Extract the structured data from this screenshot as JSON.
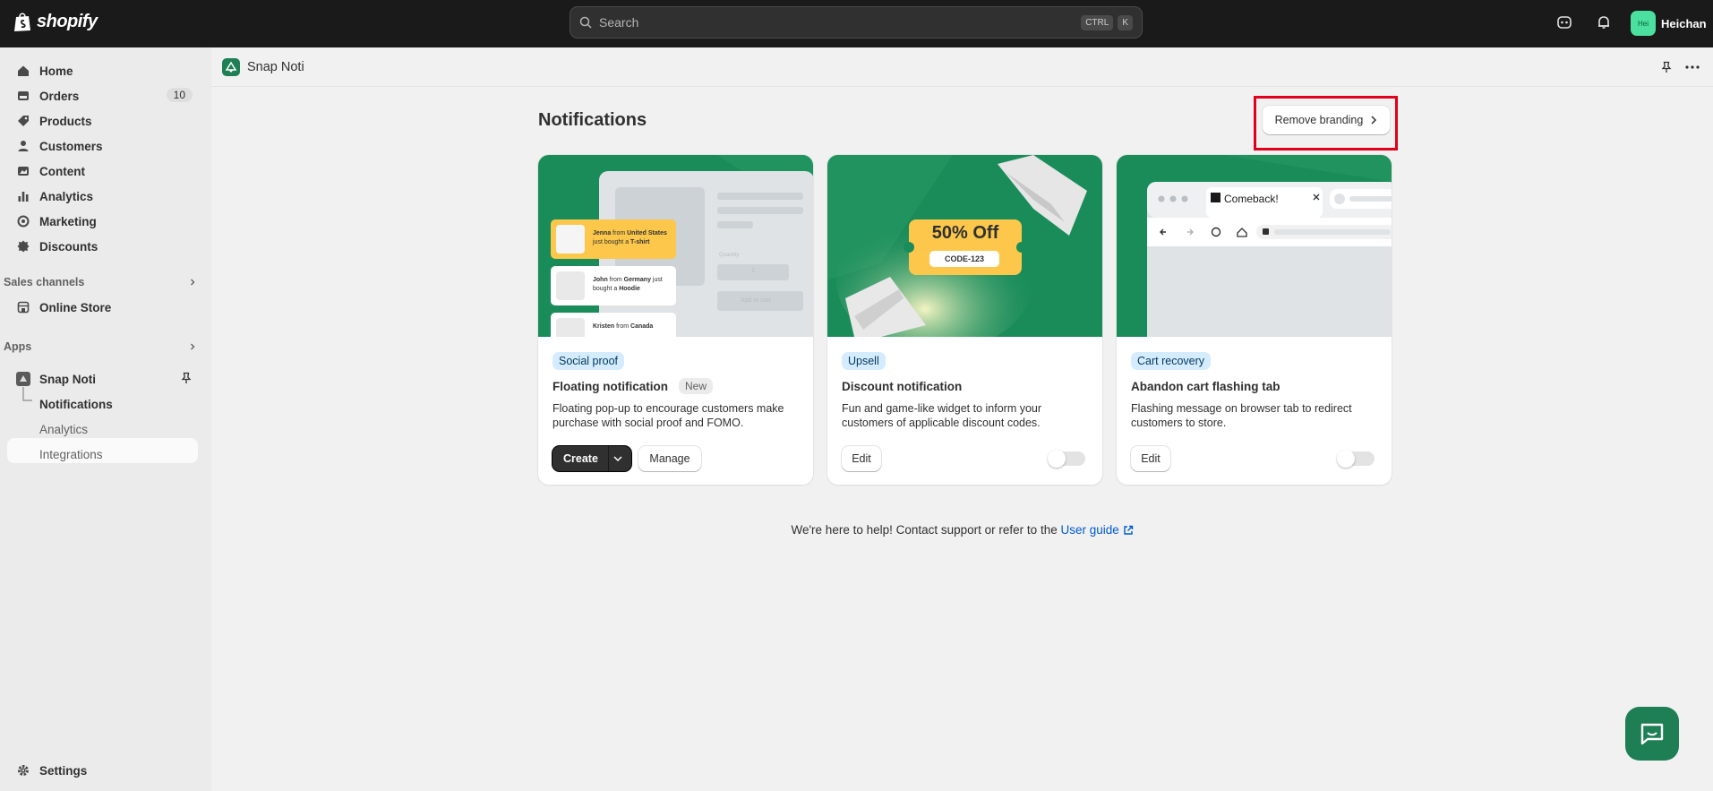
{
  "topbar": {
    "logo_text": "shopify",
    "search_placeholder": "Search",
    "shortcut_ctrl": "CTRL",
    "shortcut_k": "K",
    "user_initials": "Hei",
    "user_name": "Heichan"
  },
  "sidebar": {
    "items": [
      {
        "label": "Home",
        "icon": "home-icon"
      },
      {
        "label": "Orders",
        "icon": "orders-icon",
        "badge": "10"
      },
      {
        "label": "Products",
        "icon": "tag-icon"
      },
      {
        "label": "Customers",
        "icon": "person-icon"
      },
      {
        "label": "Content",
        "icon": "content-icon"
      },
      {
        "label": "Analytics",
        "icon": "bar-chart-icon"
      },
      {
        "label": "Marketing",
        "icon": "target-icon"
      },
      {
        "label": "Discounts",
        "icon": "discount-icon"
      }
    ],
    "sales_channels_title": "Sales channels",
    "online_store": "Online Store",
    "apps_title": "Apps",
    "app_name": "Snap Noti",
    "app_subitems": [
      "Notifications",
      "Analytics",
      "Integrations"
    ],
    "settings": "Settings"
  },
  "appbar": {
    "title": "Snap Noti"
  },
  "page": {
    "title": "Notifications",
    "remove_branding": "Remove branding",
    "help_text": "We're here to help! Contact support or refer to the ",
    "help_link": "User guide"
  },
  "cards": [
    {
      "tag": "Social proof",
      "title": "Floating notification",
      "badge": "New",
      "description": "Floating pop-up to encourage customers make purchase with social proof and FOMO.",
      "primary_button": "Create",
      "secondary_button": "Manage",
      "illustration": {
        "popups": [
          {
            "name": "Jenna",
            "location": "United States",
            "item": "T-shirt"
          },
          {
            "name": "John",
            "location": "Germany",
            "item": "Hoodie"
          },
          {
            "name": "Kristen",
            "location": "Canada",
            "item": ""
          }
        ],
        "quantity_label": "Quantity",
        "quantity_value": "1",
        "cart_label": "Add to cart"
      }
    },
    {
      "tag": "Upsell",
      "title": "Discount notification",
      "description": "Fun and game-like widget to inform your customers of applicable discount codes.",
      "button": "Edit",
      "enabled": false,
      "illustration": {
        "offer": "50% Off",
        "code": "CODE-123"
      }
    },
    {
      "tag": "Cart recovery",
      "title": "Abandon cart flashing tab",
      "description": "Flashing message on browser tab to redirect customers to store.",
      "button": "Edit",
      "enabled": false,
      "illustration": {
        "tab_title": "Comeback!"
      }
    }
  ],
  "colors": {
    "brand_green": "#198c5a",
    "dark_topbar": "#1a1a1a",
    "link": "#005bd3",
    "highlight_red": "#e0001b"
  }
}
